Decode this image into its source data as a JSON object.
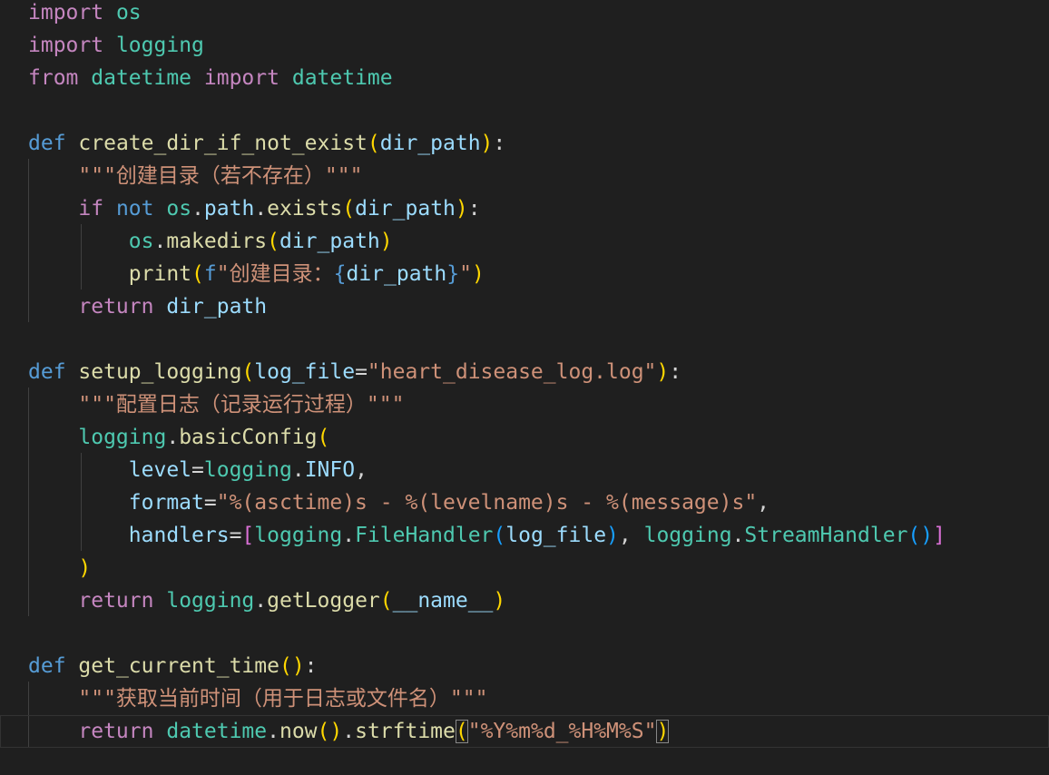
{
  "theme": {
    "background": "#1f1f1f",
    "keyword_control": "#c586c0",
    "keyword_def": "#569cd6",
    "module": "#4ec9b0",
    "function": "#dcdcaa",
    "variable": "#9cdcfe",
    "string": "#ce9178",
    "bracket_1": "#ffd700",
    "bracket_2": "#da70d6",
    "bracket_3": "#179fff",
    "plain": "#d4d4d4"
  },
  "editor": {
    "active_line": 22,
    "lines": [
      [
        [
          "import",
          "kw"
        ],
        [
          " ",
          "p"
        ],
        [
          "os",
          "mod"
        ]
      ],
      [
        [
          "import",
          "kw"
        ],
        [
          " ",
          "p"
        ],
        [
          "logging",
          "mod"
        ]
      ],
      [
        [
          "from",
          "kw"
        ],
        [
          " ",
          "p"
        ],
        [
          "datetime",
          "mod"
        ],
        [
          " ",
          "p"
        ],
        [
          "import",
          "kw"
        ],
        [
          " ",
          "p"
        ],
        [
          "datetime",
          "mod"
        ]
      ],
      [],
      [
        [
          "def",
          "def"
        ],
        [
          " ",
          "p"
        ],
        [
          "create_dir_if_not_exist",
          "fn"
        ],
        [
          "(",
          "b1"
        ],
        [
          "dir_path",
          "var"
        ],
        [
          ")",
          "b1"
        ],
        [
          ":",
          "p"
        ]
      ],
      [
        [
          "    ",
          "p"
        ],
        [
          "\"\"\"创建目录（若不存在）\"\"\"",
          "str"
        ]
      ],
      [
        [
          "    ",
          "p"
        ],
        [
          "if",
          "kw"
        ],
        [
          " ",
          "p"
        ],
        [
          "not",
          "def"
        ],
        [
          " ",
          "p"
        ],
        [
          "os",
          "mod"
        ],
        [
          ".",
          "p"
        ],
        [
          "path",
          "var"
        ],
        [
          ".",
          "p"
        ],
        [
          "exists",
          "fn"
        ],
        [
          "(",
          "b1"
        ],
        [
          "dir_path",
          "var"
        ],
        [
          ")",
          "b1"
        ],
        [
          ":",
          "p"
        ]
      ],
      [
        [
          "        ",
          "p"
        ],
        [
          "os",
          "mod"
        ],
        [
          ".",
          "p"
        ],
        [
          "makedirs",
          "fn"
        ],
        [
          "(",
          "b1"
        ],
        [
          "dir_path",
          "var"
        ],
        [
          ")",
          "b1"
        ]
      ],
      [
        [
          "        ",
          "p"
        ],
        [
          "print",
          "fn"
        ],
        [
          "(",
          "b1"
        ],
        [
          "f",
          "def"
        ],
        [
          "\"创建目录：",
          "str"
        ],
        [
          "{",
          "def"
        ],
        [
          "dir_path",
          "var"
        ],
        [
          "}",
          "def"
        ],
        [
          "\"",
          "str"
        ],
        [
          ")",
          "b1"
        ]
      ],
      [
        [
          "    ",
          "p"
        ],
        [
          "return",
          "kw"
        ],
        [
          " ",
          "p"
        ],
        [
          "dir_path",
          "var"
        ]
      ],
      [],
      [
        [
          "def",
          "def"
        ],
        [
          " ",
          "p"
        ],
        [
          "setup_logging",
          "fn"
        ],
        [
          "(",
          "b1"
        ],
        [
          "log_file",
          "var"
        ],
        [
          "=",
          "p"
        ],
        [
          "\"heart_disease_log.log\"",
          "str"
        ],
        [
          ")",
          "b1"
        ],
        [
          ":",
          "p"
        ]
      ],
      [
        [
          "    ",
          "p"
        ],
        [
          "\"\"\"配置日志（记录运行过程）\"\"\"",
          "str"
        ]
      ],
      [
        [
          "    ",
          "p"
        ],
        [
          "logging",
          "mod"
        ],
        [
          ".",
          "p"
        ],
        [
          "basicConfig",
          "fn"
        ],
        [
          "(",
          "b1"
        ]
      ],
      [
        [
          "        ",
          "p"
        ],
        [
          "level",
          "var"
        ],
        [
          "=",
          "p"
        ],
        [
          "logging",
          "mod"
        ],
        [
          ".",
          "p"
        ],
        [
          "INFO",
          "var"
        ],
        [
          ",",
          "p"
        ]
      ],
      [
        [
          "        ",
          "p"
        ],
        [
          "format",
          "var"
        ],
        [
          "=",
          "p"
        ],
        [
          "\"%(asctime)s - %(levelname)s - %(message)s\"",
          "str"
        ],
        [
          ",",
          "p"
        ]
      ],
      [
        [
          "        ",
          "p"
        ],
        [
          "handlers",
          "var"
        ],
        [
          "=",
          "p"
        ],
        [
          "[",
          "b2"
        ],
        [
          "logging",
          "mod"
        ],
        [
          ".",
          "p"
        ],
        [
          "FileHandler",
          "mod"
        ],
        [
          "(",
          "b3"
        ],
        [
          "log_file",
          "var"
        ],
        [
          ")",
          "b3"
        ],
        [
          ", ",
          "p"
        ],
        [
          "logging",
          "mod"
        ],
        [
          ".",
          "p"
        ],
        [
          "StreamHandler",
          "mod"
        ],
        [
          "()",
          "b3"
        ],
        [
          "]",
          "b2"
        ]
      ],
      [
        [
          "    ",
          "p"
        ],
        [
          ")",
          "b1"
        ]
      ],
      [
        [
          "    ",
          "p"
        ],
        [
          "return",
          "kw"
        ],
        [
          " ",
          "p"
        ],
        [
          "logging",
          "mod"
        ],
        [
          ".",
          "p"
        ],
        [
          "getLogger",
          "fn"
        ],
        [
          "(",
          "b1"
        ],
        [
          "__name__",
          "var"
        ],
        [
          ")",
          "b1"
        ]
      ],
      [],
      [
        [
          "def",
          "def"
        ],
        [
          " ",
          "p"
        ],
        [
          "get_current_time",
          "fn"
        ],
        [
          "()",
          "b1"
        ],
        [
          ":",
          "p"
        ]
      ],
      [
        [
          "    ",
          "p"
        ],
        [
          "\"\"\"获取当前时间（用于日志或文件名）\"\"\"",
          "str"
        ]
      ],
      [
        [
          "    ",
          "p"
        ],
        [
          "return",
          "kw"
        ],
        [
          " ",
          "p"
        ],
        [
          "datetime",
          "mod"
        ],
        [
          ".",
          "p"
        ],
        [
          "now",
          "fn"
        ],
        [
          "()",
          "b1"
        ],
        [
          ".",
          "p"
        ],
        [
          "strftime",
          "fn"
        ],
        [
          "(",
          "b1m"
        ],
        [
          "\"%Y%m%d_%H%M%S\"",
          "str"
        ],
        [
          ")",
          "b1m"
        ]
      ]
    ]
  }
}
